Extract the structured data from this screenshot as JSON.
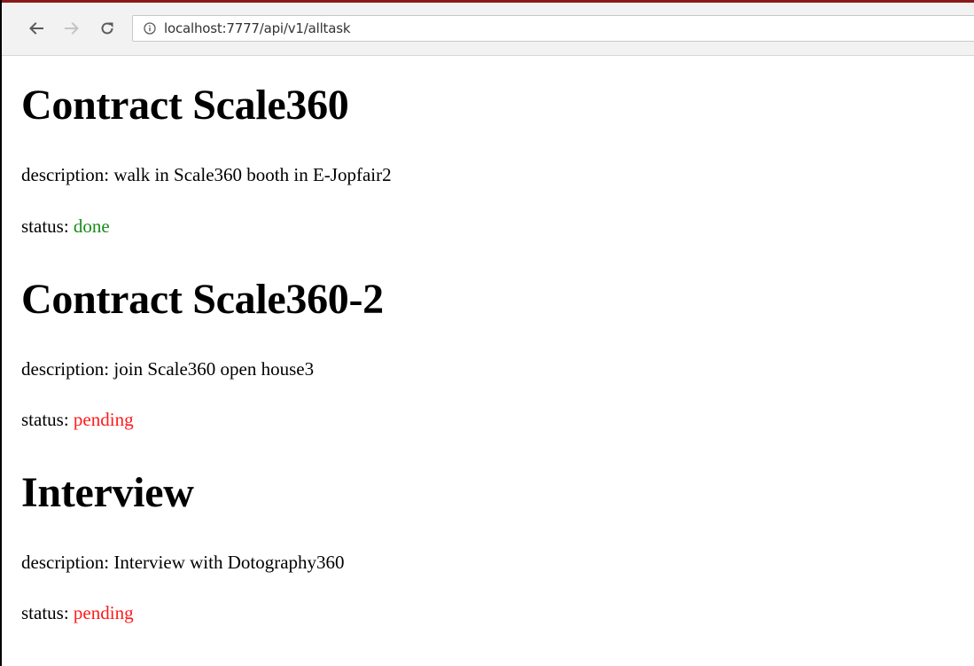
{
  "browser": {
    "url": "localhost:7777/api/v1/alltask"
  },
  "tasks": [
    {
      "title": "Contract Scale360",
      "description_prefix": "description: ",
      "description": "walk in Scale360 booth in E-Jopfair2",
      "status_prefix": "status: ",
      "status": "done",
      "status_color": "#1a8a1a"
    },
    {
      "title": "Contract Scale360-2",
      "description_prefix": "description: ",
      "description": "join Scale360 open house3",
      "status_prefix": "status: ",
      "status": "pending",
      "status_color": "#ff1a1a"
    },
    {
      "title": "Interview",
      "description_prefix": "description: ",
      "description": "Interview with Dotography360",
      "status_prefix": "status: ",
      "status": "pending",
      "status_color": "#ff1a1a"
    }
  ]
}
